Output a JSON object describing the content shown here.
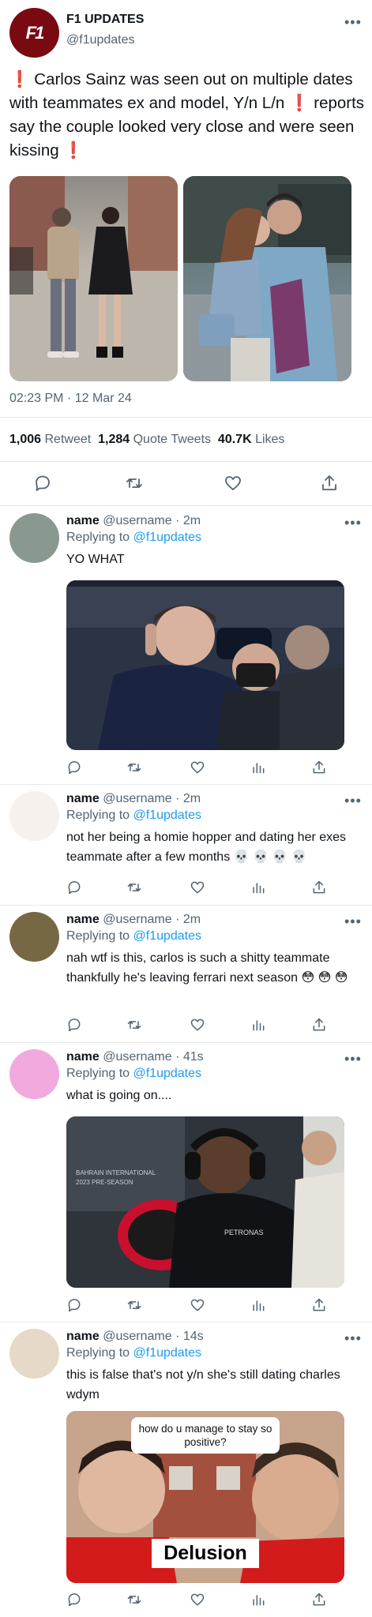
{
  "main_tweet": {
    "display_name": "F1 UPDATES",
    "handle": "@f1updates",
    "avatar_logo": "F1",
    "bang": "❗",
    "text_1": "Carlos Sainz was seen out on multiple dates with teammates ex and model, Y/n L/n",
    "text_2": " reports say the couple looked very close and were seen kissing ",
    "timestamp": "02:23 PM · 12 Mar 24",
    "retweets_count": "1,006",
    "retweets_label": "Retweet",
    "quotes_count": "1,284",
    "quotes_label": "Quote Tweets",
    "likes_count": "40.7K",
    "likes_label": "Likes",
    "more": "•••"
  },
  "replies": [
    {
      "name": "name",
      "meta": "@username · 2m",
      "replying_label": "Replying to",
      "replying_to": "@f1updates",
      "text": "YO WHAT",
      "avatar_color": "#8a9990",
      "image": "photo-driver-phone",
      "more": "•••"
    },
    {
      "name": "name",
      "meta": "@username · 2m",
      "replying_label": "Replying to",
      "replying_to": "@f1updates",
      "text": "not her being a homie hopper and dating her exes teammate after a few months 💀 💀 💀 💀",
      "avatar_color": "#f6f1ec",
      "more": "•••"
    },
    {
      "name": "name",
      "meta": "@username · 2m",
      "replying_label": "Replying to",
      "replying_to": "@f1updates",
      "text": "nah wtf is this, carlos is such a shitty teammate thankfully he's leaving ferrari next season 😳 😳 😳",
      "avatar_color": "#776845",
      "more": "•••"
    },
    {
      "name": "name",
      "meta": "@username · 41s",
      "replying_label": "Replying to",
      "replying_to": "@f1updates",
      "text": "what is going on....",
      "avatar_color": "#f2a9de",
      "image": "photo-driver-headset",
      "image_caption": "BAHRAIN INTERNATIONAL\n2023 PRE-SEASON",
      "more": "•••"
    },
    {
      "name": "name",
      "meta": "@username · 14s",
      "replying_label": "Replying to",
      "replying_to": "@f1updates",
      "text": "this is false that's not y/n she's still dating charles wdym",
      "avatar_color": "#e6d9c8",
      "image": "meme-delusion",
      "meme_top": "how do u manage to stay so positive?",
      "meme_bottom": "Delusion",
      "more": "•••"
    }
  ],
  "actions": [
    "reply-icon",
    "retweet-icon",
    "like-icon",
    "stats-icon",
    "share-icon"
  ]
}
